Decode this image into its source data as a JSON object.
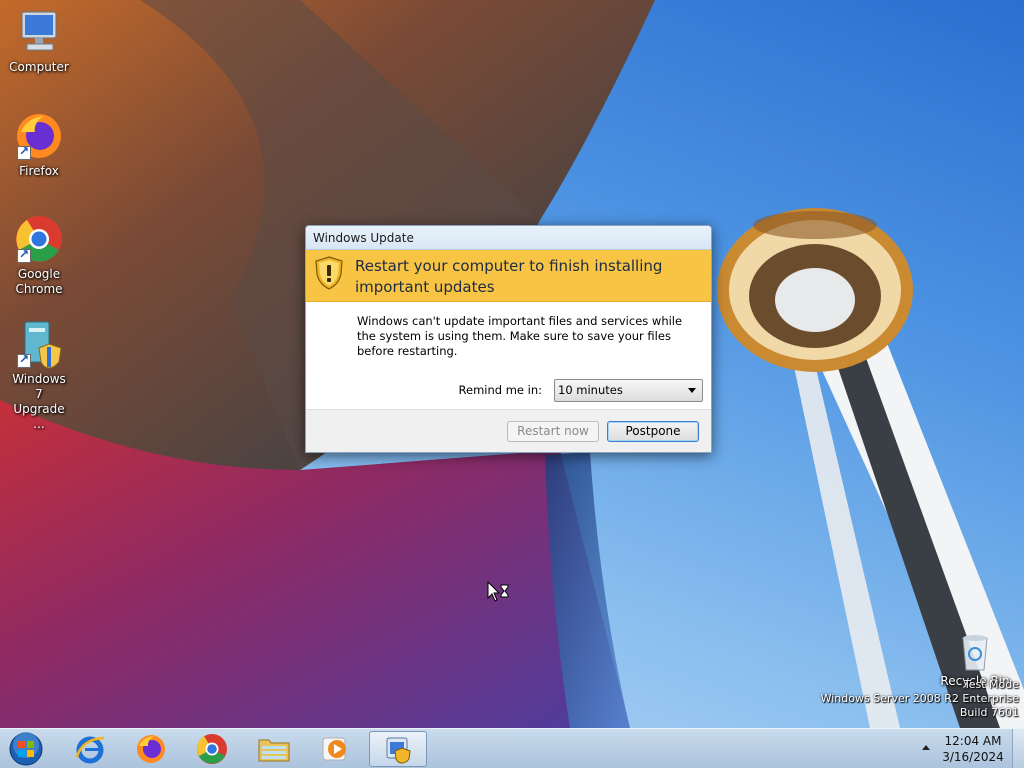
{
  "desktop": {
    "icons": [
      {
        "label": "Computer",
        "icon": "computer-icon"
      },
      {
        "label": "Firefox",
        "icon": "firefox-icon"
      },
      {
        "label": "Google Chrome",
        "icon": "chrome-icon"
      },
      {
        "label": "Windows 7 Upgrade ...",
        "icon": "windows7-upgrade-icon"
      },
      {
        "label": "Recycle Bin",
        "icon": "recycle-bin-icon"
      }
    ]
  },
  "dialog": {
    "title": "Windows Update",
    "headline": "Restart your computer to finish installing important updates",
    "message": "Windows can't update important files and services while the system is using them. Make sure to save your files before restarting.",
    "remind_label": "Remind me in:",
    "remind_value": "10 minutes",
    "restart_label": "Restart now",
    "postpone_label": "Postpone",
    "banner_color": "#f7c443"
  },
  "watermark": {
    "line1": "Test Mode",
    "line2": "Windows Server 2008 R2 Enterprise",
    "line3": "Build 7601"
  },
  "taskbar": {
    "start_icon": "windows-start-orb",
    "pinned": [
      {
        "icon": "internet-explorer-icon"
      },
      {
        "icon": "firefox-icon"
      },
      {
        "icon": "chrome-icon"
      },
      {
        "icon": "file-explorer-icon"
      },
      {
        "icon": "media-player-icon"
      },
      {
        "icon": "windows-update-icon",
        "active": true
      }
    ],
    "clock_time": "12:04 AM",
    "clock_date": "3/16/2024"
  }
}
